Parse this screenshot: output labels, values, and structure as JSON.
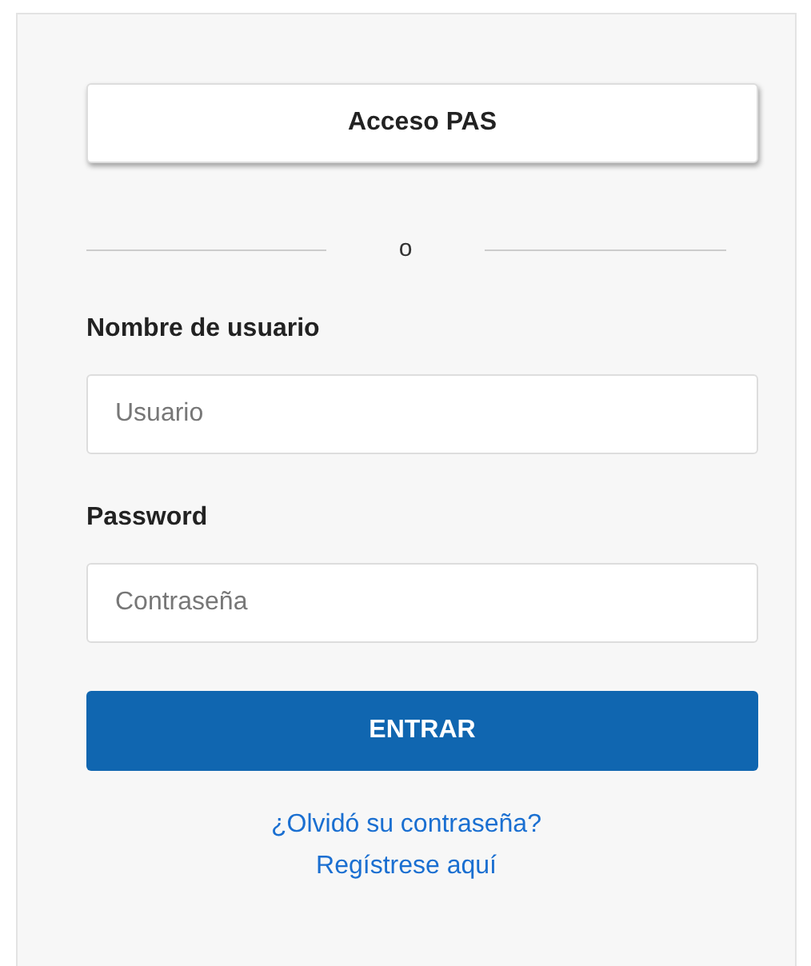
{
  "pas_button": "Acceso PAS",
  "divider": "o",
  "fields": [
    {
      "label": "Nombre de usuario",
      "placeholder": "Usuario"
    },
    {
      "label": "Password",
      "placeholder": "Contraseña"
    }
  ],
  "submit": "ENTRAR",
  "links": [
    "¿Olvidó su contraseña?",
    "Regístrese aquí"
  ]
}
